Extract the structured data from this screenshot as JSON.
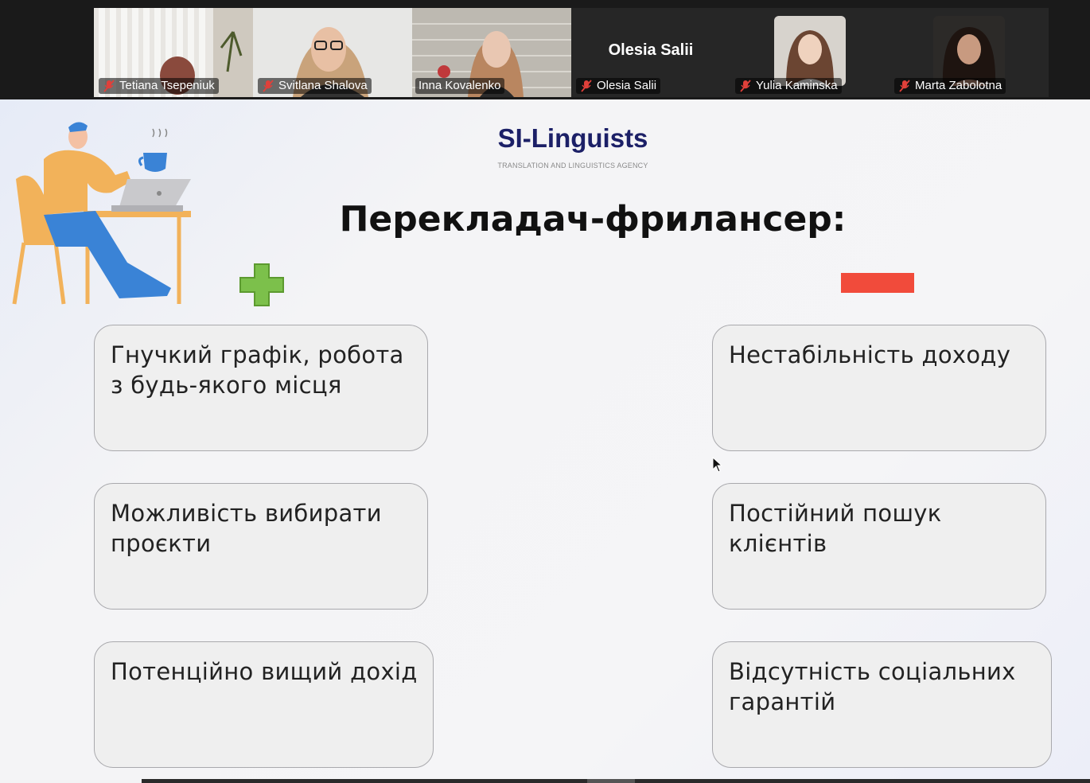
{
  "participants": [
    {
      "name": "Tetiana Tsepeniuk",
      "muted": true
    },
    {
      "name": "Svitlana Shalova",
      "muted": true
    },
    {
      "name": "Inna Kovalenko",
      "muted": false,
      "active_speaker": true
    },
    {
      "name": "Olesia Salii",
      "muted": true,
      "center_label": "Olesia Salii"
    },
    {
      "name": "Yulia Kaminska",
      "muted": true
    },
    {
      "name": "Marta Zabolotna",
      "muted": true
    }
  ],
  "slide": {
    "logo_title": "SI-Linguists",
    "logo_subtitle": "TRANSLATION AND LINGUISTICS AGENCY",
    "heading": "Перекладач-фрилансер:",
    "pros_icon": "plus-icon",
    "cons_icon": "minus-icon",
    "pros": [
      "Гнучкий графік, робота з будь-якого місця",
      "Можливість вибирати проєкти",
      "Потенційно вищий дохід"
    ],
    "cons": [
      "Нестабільність доходу",
      "Постійний пошук клієнтів",
      "Відсутність соціальних гарантій"
    ]
  },
  "colors": {
    "active_speaker_border": "#23d18b",
    "plus": "#7cc04b",
    "minus": "#f14b3b",
    "logo": "#1c2067"
  }
}
